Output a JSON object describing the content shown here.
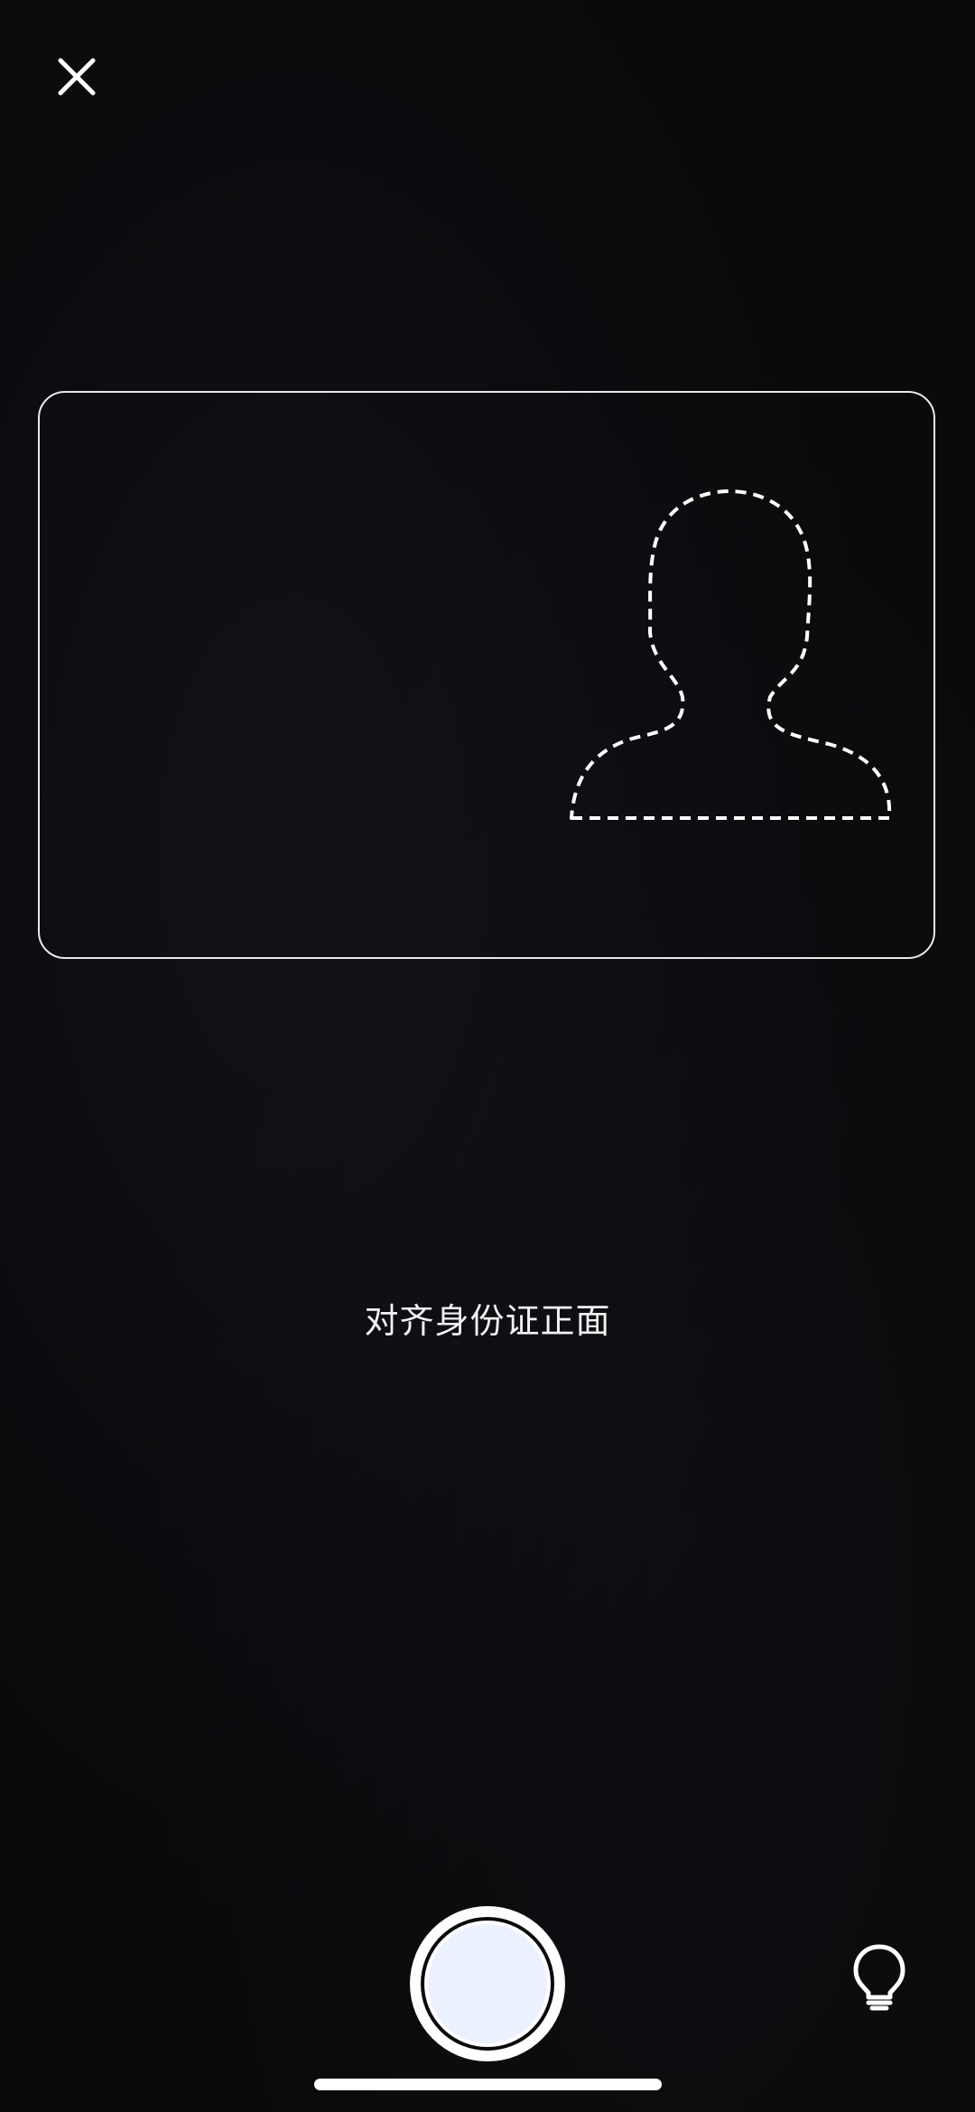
{
  "screen": {
    "hint": "对齐身份证正面"
  },
  "icons": {
    "close": "close-icon",
    "portrait": "person-silhouette-outline-icon",
    "tips": "lightbulb-icon"
  },
  "colors": {
    "background": "#0a0a0c",
    "frame": "#e9e9e9",
    "shutter_fill": "#ecf1ff",
    "foreground": "#ffffff"
  }
}
